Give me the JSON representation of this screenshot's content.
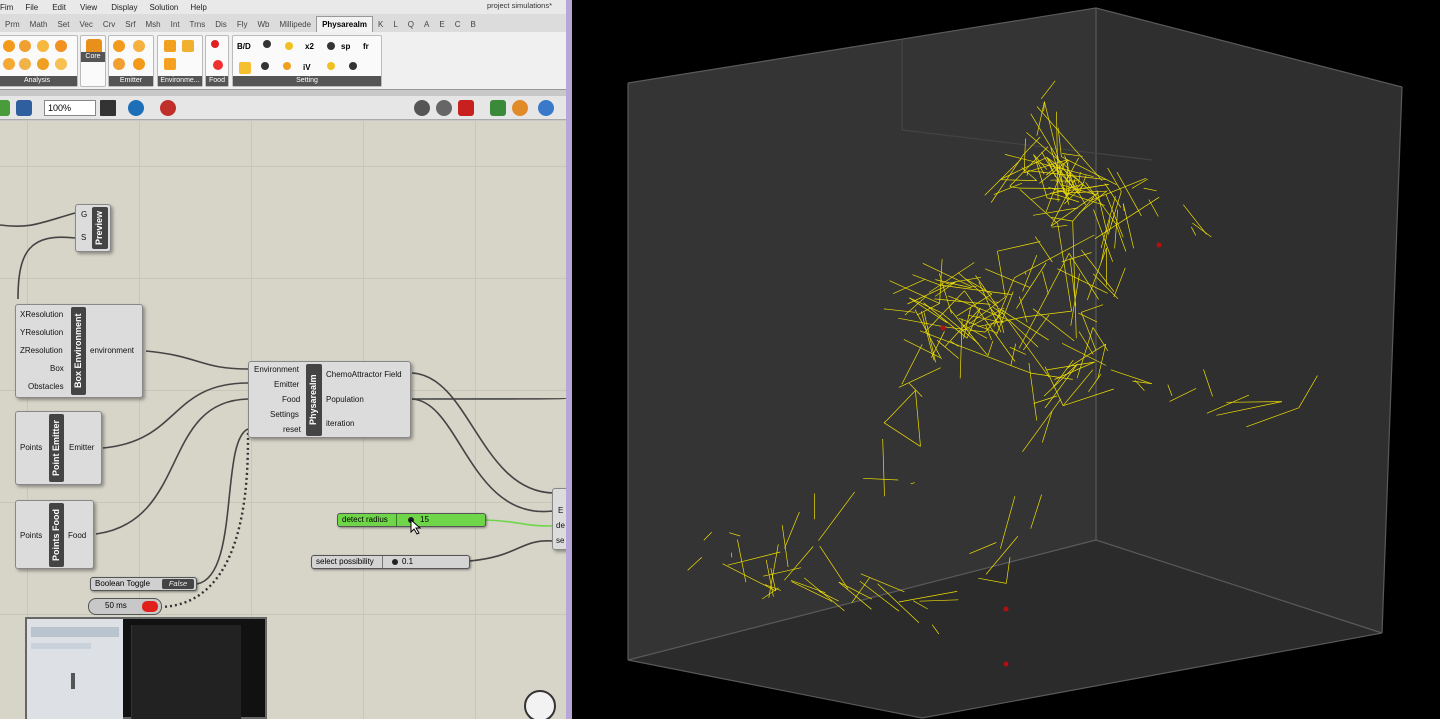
{
  "menu": {
    "items": [
      "Fim",
      "File",
      "Edit",
      "View",
      "Display",
      "Solution",
      "Help"
    ],
    "doc_title": "project simulations*"
  },
  "tabs": [
    "Prm",
    "Math",
    "Set",
    "Vec",
    "Crv",
    "Srf",
    "Msh",
    "Int",
    "Trns",
    "Dis",
    "Fly",
    "Wb",
    "Millipede",
    "Physarealm",
    "K",
    "L",
    "Q",
    "A",
    "E",
    "C",
    "B"
  ],
  "active_tab": "Physarealm",
  "ribbon_groups": [
    "Analysis",
    "Core",
    "Emitter",
    "Environme...",
    "Food",
    "Setting"
  ],
  "ribbon_setting_icons": [
    "B/D",
    "x2",
    "sp",
    "fr",
    "iV"
  ],
  "toolbar": {
    "zoom": "100%"
  },
  "components": {
    "preview": {
      "label": "Preview",
      "inputs": [
        "G",
        "S"
      ]
    },
    "box_environment": {
      "label": "Box Environment",
      "inputs": [
        "XResolution",
        "YResolution",
        "ZResolution",
        "Box",
        "Obstacles"
      ],
      "output": "environment"
    },
    "physarealm": {
      "label": "Physarealm",
      "inputs": [
        "Environment",
        "Emitter",
        "Food",
        "Settings",
        "reset"
      ],
      "outputs": [
        "ChemoAttractor Field",
        "Population",
        "iteration"
      ]
    },
    "point_emitter": {
      "label": "Point Emitter",
      "input": "Points",
      "output": "Emitter"
    },
    "points_food": {
      "label": "Points Food",
      "input": "Points",
      "output": "Food"
    },
    "partial_right": {
      "labels": [
        "E",
        "de",
        "se"
      ]
    }
  },
  "sliders": {
    "detect_radius": {
      "label": "detect radius",
      "value": "15"
    },
    "select_possibility": {
      "label": "select possibility",
      "value": "0.1"
    }
  },
  "toggle": {
    "label": "Boolean Toggle",
    "value": "False"
  },
  "timer": {
    "label": "50 ms"
  },
  "colors": {
    "accent": "#f0e000",
    "canvas": "#d7d4c8",
    "slider_green": "#6fd64a",
    "viewport": "#000000"
  }
}
